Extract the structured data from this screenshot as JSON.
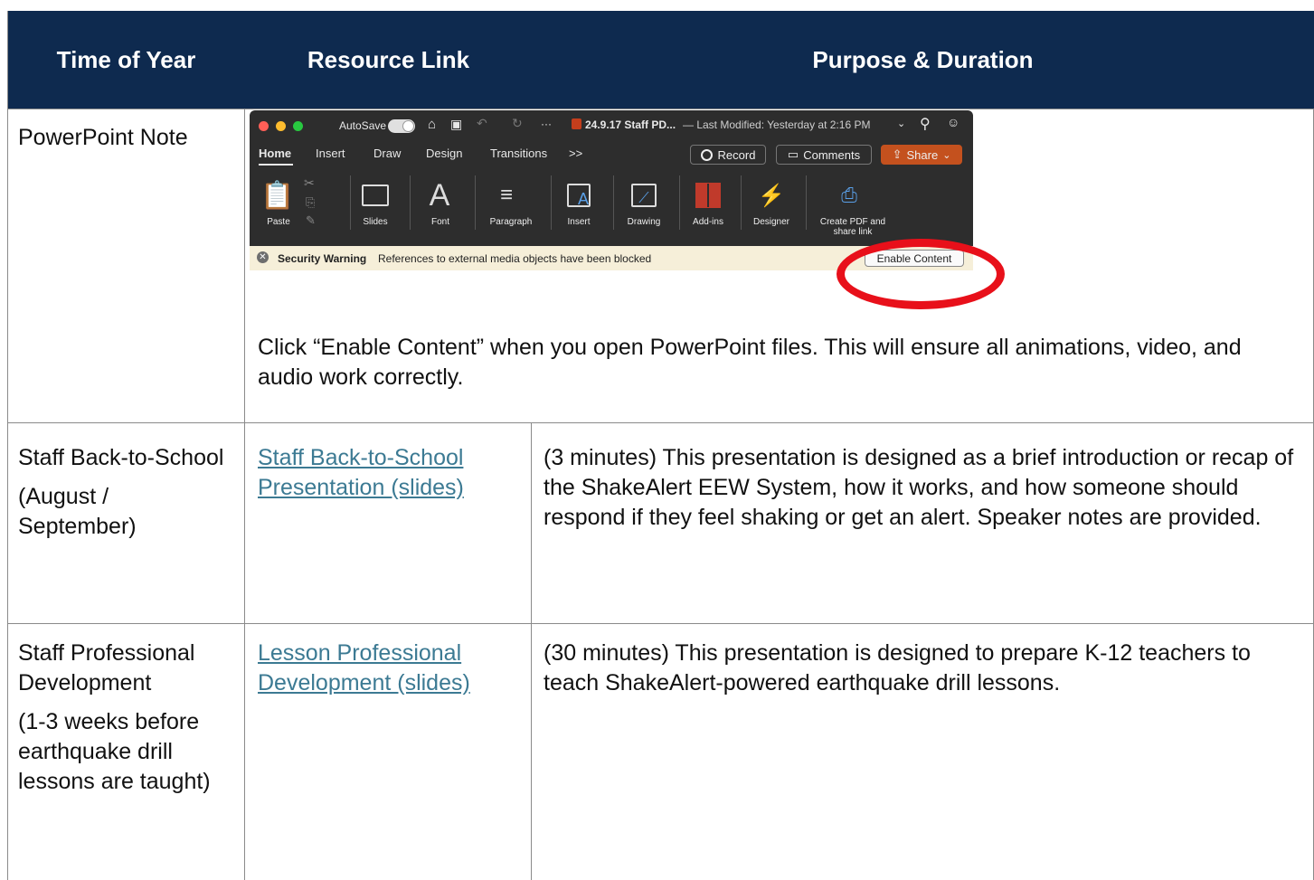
{
  "table": {
    "headers": [
      "Time of Year",
      "Resource Link",
      "Purpose & Duration"
    ],
    "row1": {
      "time": "PowerPoint Note",
      "instruction": "Click “Enable Content” when you open PowerPoint files. This will ensure all animations, video, and audio work correctly."
    },
    "row2": {
      "time_line1": "Staff Back-to-School",
      "time_line2": "(August / September)",
      "link": "Staff Back-to-School Presentation (slides)",
      "purpose": "(3 minutes) This presentation is designed as a brief introduction or recap of the ShakeAlert EEW System, how it works, and how someone should respond if they feel shaking or get an alert. Speaker notes are provided."
    },
    "row3": {
      "time_line1": "Staff Professional Development",
      "time_line2": "(1-3 weeks before earthquake drill lessons are taught)",
      "link": "Lesson Professional Development (slides)",
      "purpose": "(30 minutes) This presentation is designed to prepare K-12 teachers to teach ShakeAlert-powered earthquake drill lessons."
    }
  },
  "screenshot": {
    "autosave_label": "AutoSave",
    "file_title": "24.9.17 Staff PD...",
    "modified": "— Last Modified: Yesterday at 2:16 PM",
    "tabs": [
      "Home",
      "Insert",
      "Draw",
      "Design",
      "Transitions",
      ">>"
    ],
    "record_label": "Record",
    "comments_label": "Comments",
    "share_label": "Share",
    "groups": [
      "Paste",
      "Slides",
      "Font",
      "Paragraph",
      "Insert",
      "Drawing",
      "Add-ins",
      "Designer",
      "Create PDF and share link"
    ],
    "warning_title": "Security Warning",
    "warning_text": "References to external media objects have been blocked",
    "enable_label": "Enable Content",
    "colors": {
      "close": "#ff5f57",
      "minimize": "#febc2e",
      "maximize": "#28c840",
      "share": "#c4511e",
      "highlight": "#e8101a"
    }
  }
}
